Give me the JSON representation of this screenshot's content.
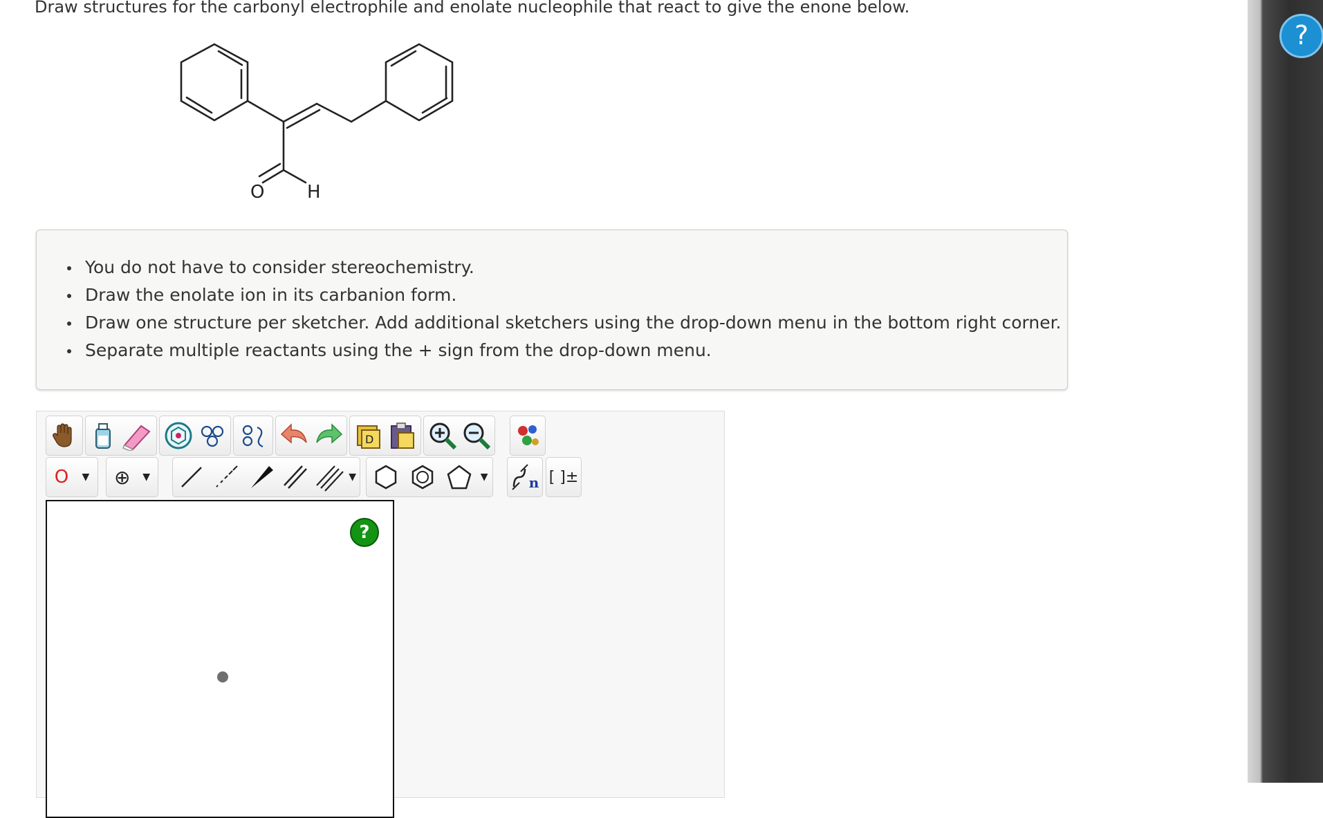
{
  "question": {
    "prompt": "Draw structures for the carbonyl electrophile and enolate nucleophile that react to give the enone below."
  },
  "molecule": {
    "atom_labels": [
      "O",
      "H"
    ],
    "description_icon": "enone-structure"
  },
  "notes": [
    "You do not have to consider stereochemistry.",
    "Draw the enolate ion in its carbanion form.",
    "Draw one structure per sketcher. Add additional sketchers using the drop-down menu in the bottom right corner.",
    "Separate multiple reactants using the + sign from the drop-down menu."
  ],
  "toolbar": {
    "atom_selector_value": "O",
    "charge_selector_value": "⊕",
    "bracket_label": "[ ]±",
    "sgroup_label": "n",
    "icons_row1": [
      "hand-move-icon",
      "erase-all-icon",
      "eraser-icon",
      "ring-template-icon",
      "clean-2d-icon",
      "clean-3d-icon",
      "undo-icon",
      "redo-icon",
      "copy-icon",
      "paste-icon",
      "zoom-in-icon",
      "zoom-out-icon",
      "color-atoms-icon"
    ],
    "icons_row2": [
      "atom-dropdown",
      "charge-dropdown",
      "single-bond-icon",
      "hash-bond-icon",
      "wedge-bond-icon",
      "double-bond-icon",
      "triple-bond-dropdown",
      "cyclohexane-icon",
      "benzene-icon",
      "cyclopentane-dropdown",
      "sgroup-icon",
      "bracket-icon"
    ]
  },
  "canvas": {
    "help_label": "?"
  },
  "page_help": {
    "label": "?"
  },
  "colors": {
    "atom_O": "#e02020",
    "help_green": "#149414",
    "help_blue": "#1d8fd3"
  }
}
